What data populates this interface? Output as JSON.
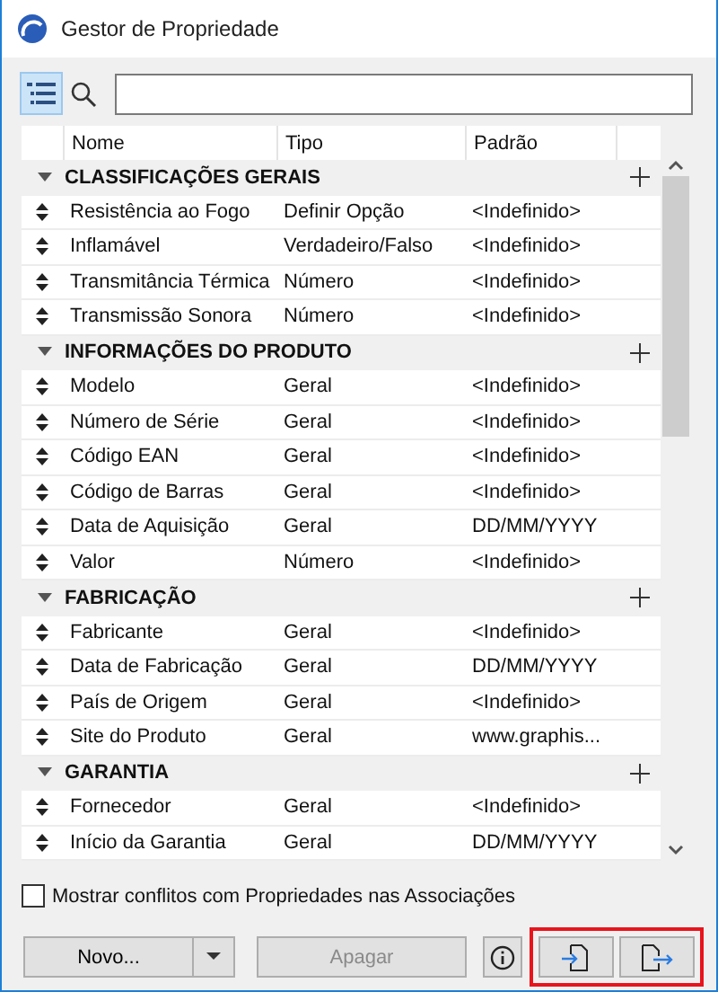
{
  "window": {
    "title": "Gestor de Propriedade"
  },
  "toolbar": {
    "tree_view_on": true
  },
  "table": {
    "columns": [
      "Nome",
      "Tipo",
      "Padrão"
    ],
    "groups": [
      {
        "name": "CLASSIFICAÇÕES GERAIS",
        "expanded": true,
        "rows": [
          {
            "name": "Resistência ao Fogo",
            "type": "Definir Opção",
            "default": "<Indefinido>"
          },
          {
            "name": "Inflamável",
            "type": "Verdadeiro/Falso",
            "default": "<Indefinido>"
          },
          {
            "name": "Transmitância Térmica",
            "type": "Número",
            "default": "<Indefinido>"
          },
          {
            "name": "Transmissão Sonora",
            "type": "Número",
            "default": "<Indefinido>"
          }
        ]
      },
      {
        "name": "INFORMAÇÕES DO PRODUTO",
        "expanded": true,
        "rows": [
          {
            "name": "Modelo",
            "type": "Geral",
            "default": "<Indefinido>"
          },
          {
            "name": "Número de Série",
            "type": "Geral",
            "default": "<Indefinido>"
          },
          {
            "name": "Código EAN",
            "type": "Geral",
            "default": "<Indefinido>"
          },
          {
            "name": "Código de Barras",
            "type": "Geral",
            "default": "<Indefinido>"
          },
          {
            "name": "Data de Aquisição",
            "type": "Geral",
            "default": "DD/MM/YYYY"
          },
          {
            "name": "Valor",
            "type": "Número",
            "default": "<Indefinido>"
          }
        ]
      },
      {
        "name": "FABRICAÇÃO",
        "expanded": true,
        "rows": [
          {
            "name": "Fabricante",
            "type": "Geral",
            "default": "<Indefinido>"
          },
          {
            "name": "Data de Fabricação",
            "type": "Geral",
            "default": "DD/MM/YYYY"
          },
          {
            "name": "País de Origem",
            "type": "Geral",
            "default": "<Indefinido>"
          },
          {
            "name": "Site do Produto",
            "type": "Geral",
            "default": "www.graphis..."
          }
        ]
      },
      {
        "name": "GARANTIA",
        "expanded": true,
        "rows": [
          {
            "name": "Fornecedor",
            "type": "Geral",
            "default": "<Indefinido>"
          },
          {
            "name": "Início da Garantia",
            "type": "Geral",
            "default": "DD/MM/YYYY"
          }
        ]
      }
    ]
  },
  "conflicts_checkbox": {
    "label": "Mostrar conflitos com Propriedades nas Associações",
    "checked": false
  },
  "buttons": {
    "new": "Novo...",
    "delete": {
      "label": "Apagar",
      "disabled": true
    },
    "import_export_highlighted": true
  }
}
